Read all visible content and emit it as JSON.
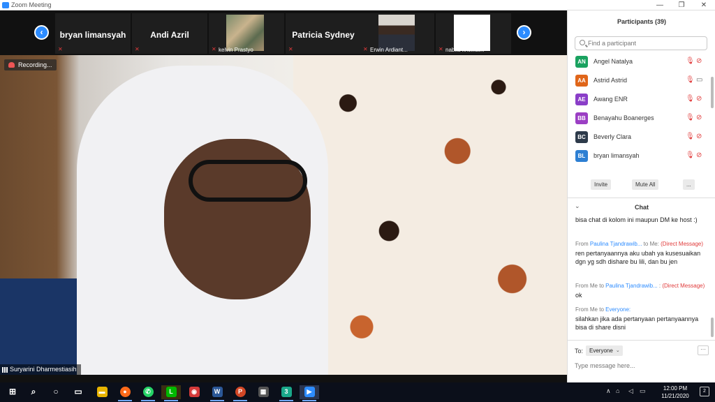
{
  "window": {
    "title": "Zoom Meeting",
    "controls": [
      "—",
      "❐",
      "✕"
    ]
  },
  "strip": {
    "tiles": [
      {
        "name": "bryan limansyah",
        "kind": "name"
      },
      {
        "name": "Andi Azril",
        "kind": "name"
      },
      {
        "name": "kelvin Prastyo",
        "kind": "video"
      },
      {
        "name": "Patricia Sydney",
        "kind": "name"
      },
      {
        "name": "Erwin Ardiant...",
        "kind": "video"
      },
      {
        "name": "nabila kholifat...",
        "kind": "video"
      }
    ],
    "prev": "‹",
    "next": "›"
  },
  "video": {
    "recording_label": "Recording...",
    "speaker_name": "Suryarini Dharmestiasih"
  },
  "participants": {
    "title": "Participants (39)",
    "search_placeholder": "Find a participant",
    "list": [
      {
        "initials": "AN",
        "name": "Angel Natalya",
        "color": "#1aa260",
        "cam_on": false
      },
      {
        "initials": "AA",
        "name": "Astrid Astrid",
        "color": "#e0661a",
        "cam_on": true
      },
      {
        "initials": "AE",
        "name": "Awang ENR",
        "color": "#8a3ec8",
        "cam_on": false
      },
      {
        "initials": "BB",
        "name": "Benayahu Boanerges",
        "color": "#9b3fc4",
        "cam_on": false
      },
      {
        "initials": "BC",
        "name": "Beverly Clara",
        "color": "#2d3a4a",
        "cam_on": false
      },
      {
        "initials": "BL",
        "name": "bryan limansyah",
        "color": "#2d7fd3",
        "cam_on": false
      }
    ],
    "buttons": {
      "invite": "Invite",
      "mute_all": "Mute All",
      "more": "..."
    }
  },
  "chat": {
    "title": "Chat",
    "messages": [
      {
        "header": null,
        "text": "bisa chat di kolom ini maupun DM ke host :)"
      },
      {
        "header": {
          "prefix": "From ",
          "who": "Paulina Tjandrawib...",
          "mid": " to Me: ",
          "dm": "(Direct Message)"
        },
        "text": "ren pertanyaannya aku ubah ya kusesuaikan dgn yg sdh dishare bu lili, dan bu jen"
      },
      {
        "header": {
          "prefix": "From Me to ",
          "who": "Paulina Tjandrawib...",
          "mid": " : ",
          "dm": "(Direct Message)"
        },
        "text": "ok"
      },
      {
        "header": {
          "prefix": "From Me to ",
          "who": "Everyone:",
          "mid": "",
          "dm": ""
        },
        "text": "silahkan jika ada pertanyaan pertanyaannya bisa di share disni"
      }
    ],
    "to_label": "To:",
    "to_value": "Everyone",
    "input_placeholder": "Type message here..."
  },
  "taskbar": {
    "time": "12:00 PM",
    "date": "11/21/2020",
    "notification_count": "2",
    "apps": [
      {
        "name": "windows-start-icon",
        "glyph": "⊞",
        "color": "transparent"
      },
      {
        "name": "search-icon",
        "glyph": "⌕",
        "color": "transparent"
      },
      {
        "name": "cortana-icon",
        "glyph": "○",
        "color": "transparent"
      },
      {
        "name": "task-view-icon",
        "glyph": "▭",
        "color": "transparent"
      },
      {
        "name": "file-explorer-icon",
        "glyph": "▬",
        "color": "#e8b400"
      },
      {
        "name": "firefox-icon",
        "glyph": "●",
        "color": "#ff6a1a"
      },
      {
        "name": "whatsapp-icon",
        "glyph": "✆",
        "color": "#25d366"
      },
      {
        "name": "line-icon",
        "glyph": "L",
        "color": "#00b900"
      },
      {
        "name": "camera-app-icon",
        "glyph": "◉",
        "color": "#d43a3a"
      },
      {
        "name": "word-icon",
        "glyph": "W",
        "color": "#2b5797"
      },
      {
        "name": "powerpoint-icon",
        "glyph": "P",
        "color": "#d24726"
      },
      {
        "name": "photos-icon",
        "glyph": "▦",
        "color": "#555"
      },
      {
        "name": "green-app-icon",
        "glyph": "3",
        "color": "#1aa88a"
      },
      {
        "name": "zoom-icon",
        "glyph": "▶",
        "color": "#2d8cff"
      }
    ]
  }
}
